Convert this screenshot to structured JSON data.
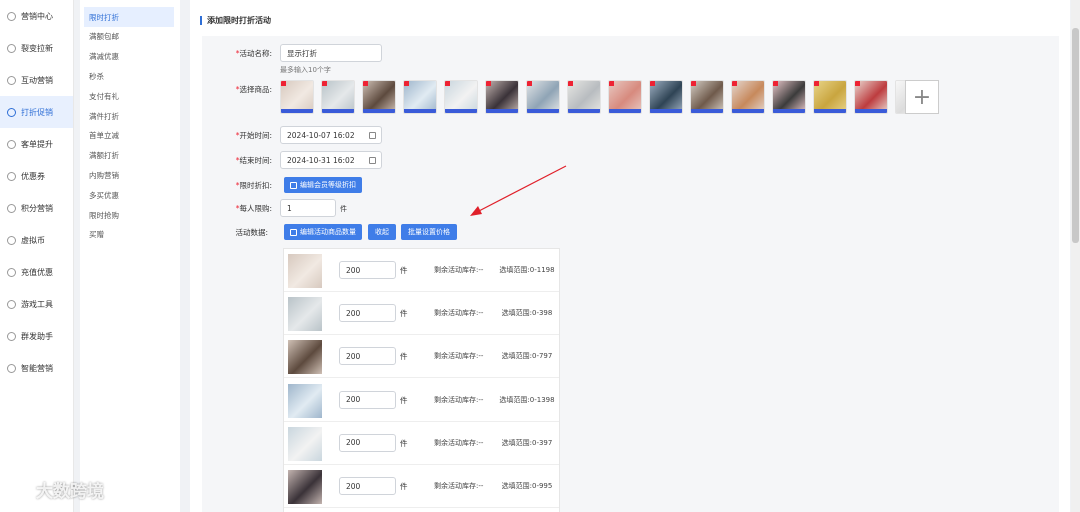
{
  "sidebar": {
    "items": [
      {
        "label": "营销中心",
        "icon": "marketing-icon"
      },
      {
        "label": "裂变拉新",
        "icon": "fission-icon"
      },
      {
        "label": "互动营销",
        "icon": "interaction-icon"
      },
      {
        "label": "打折促销",
        "icon": "discount-icon",
        "active": true
      },
      {
        "label": "客单提升",
        "icon": "order-icon"
      },
      {
        "label": "优惠券",
        "icon": "coupon-icon"
      },
      {
        "label": "积分营销",
        "icon": "points-icon"
      },
      {
        "label": "虚拟币",
        "icon": "coin-icon"
      },
      {
        "label": "充值优惠",
        "icon": "recharge-icon"
      },
      {
        "label": "游戏工具",
        "icon": "game-icon"
      },
      {
        "label": "群发助手",
        "icon": "broadcast-icon"
      },
      {
        "label": "智能营销",
        "icon": "smart-icon"
      }
    ]
  },
  "subnav": {
    "items": [
      "限时打折",
      "满额包邮",
      "满减优惠",
      "秒杀",
      "支付有礼",
      "满件打折",
      "首单立减",
      "满额打折",
      "内购营销",
      "多买优惠",
      "限时抢购",
      "买赠"
    ]
  },
  "panel": {
    "title": "添加限时打折活动",
    "name_label": "活动名称:",
    "name_value": "显示打折",
    "name_hint": "最多输入10个字",
    "goods_label": "选择商品:",
    "start_label": "开始时间:",
    "start_value": "2024-10-07 16:02",
    "end_label": "结束时间:",
    "end_value": "2024-10-31 16:02",
    "discount_label": "限时折扣:",
    "discount_btn": "编辑会员等级折扣",
    "limit_label": "每人限购:",
    "limit_value": "1",
    "limit_unit": "件",
    "data_label": "活动数据:",
    "edit_qty_btn": "编辑活动商品数量",
    "collapse_btn": "收起",
    "batch_price_btn": "批量设置价格",
    "add_symbol": "+"
  },
  "goods_thumbs": [
    {
      "bg": "#d7c9bf",
      "fg": "#f1e9e2"
    },
    {
      "bg": "#b9c3c8",
      "fg": "#e5e8ea"
    },
    {
      "bg": "#cfc0b5",
      "fg": "#5d4a3e"
    },
    {
      "bg": "#9fb6cc",
      "fg": "#e1ebf2"
    },
    {
      "bg": "#c9d6de",
      "fg": "#f2f2f2"
    },
    {
      "bg": "#c3b4b0",
      "fg": "#3a3238"
    },
    {
      "bg": "#e2e4e6",
      "fg": "#8fa4b5"
    },
    {
      "bg": "#e6e6e2",
      "fg": "#b8bcc0"
    },
    {
      "bg": "#e8c9c2",
      "fg": "#d78a7e"
    },
    {
      "bg": "#9fb0c2",
      "fg": "#2f4455"
    },
    {
      "bg": "#d4cdc4",
      "fg": "#6f5a4b"
    },
    {
      "bg": "#e4d6cf",
      "fg": "#c7895c"
    },
    {
      "bg": "#e7c6c9",
      "fg": "#3b3b3b"
    },
    {
      "bg": "#e8d48a",
      "fg": "#c9a53f"
    },
    {
      "bg": "#e9d6cf",
      "fg": "#bd3c3f"
    },
    {
      "bg": "#f7f7f7",
      "fg": "#dcdcdc"
    }
  ],
  "table_rows": [
    {
      "qty": "200",
      "unit": "件",
      "stock": "剩余活动库存:--",
      "range": "选填范围:0-1198",
      "bg": "#d7c9bf",
      "fg": "#f1e9e2"
    },
    {
      "qty": "200",
      "unit": "件",
      "stock": "剩余活动库存:--",
      "range": "选填范围:0-398",
      "bg": "#b9c3c8",
      "fg": "#e5e8ea"
    },
    {
      "qty": "200",
      "unit": "件",
      "stock": "剩余活动库存:--",
      "range": "选填范围:0-797",
      "bg": "#cfc0b5",
      "fg": "#5d4a3e"
    },
    {
      "qty": "200",
      "unit": "件",
      "stock": "剩余活动库存:--",
      "range": "选填范围:0-1398",
      "bg": "#9fb6cc",
      "fg": "#e1ebf2"
    },
    {
      "qty": "200",
      "unit": "件",
      "stock": "剩余活动库存:--",
      "range": "选填范围:0-397",
      "bg": "#c9d6de",
      "fg": "#f2f2f2"
    },
    {
      "qty": "200",
      "unit": "件",
      "stock": "剩余活动库存:--",
      "range": "选填范围:0-995",
      "bg": "#c3b4b0",
      "fg": "#3a3238"
    }
  ],
  "watermark": {
    "text": "大数跨境"
  },
  "colors": {
    "accent": "#3f7de8",
    "arrow": "#e0202a",
    "required": "#ee2233"
  }
}
